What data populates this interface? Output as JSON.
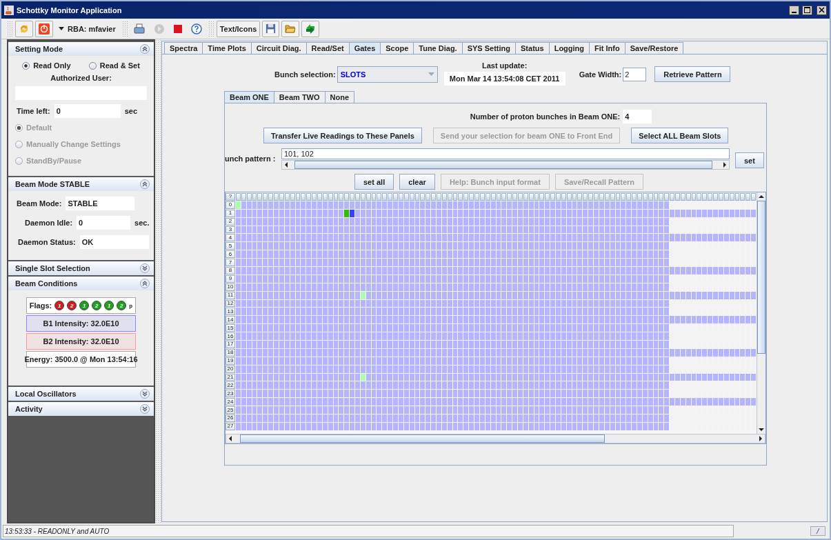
{
  "window": {
    "title": "Schottky Monitor Application"
  },
  "toolbar": {
    "groups": [
      [
        {
          "kind": "refresh"
        },
        {
          "kind": "power"
        },
        {
          "kind": "menu",
          "label": "RBA: mfavier"
        }
      ],
      [
        {
          "kind": "print"
        },
        {
          "kind": "play"
        },
        {
          "kind": "stop"
        },
        {
          "kind": "help"
        }
      ],
      [
        {
          "kind": "text",
          "label": "Text/Icons"
        },
        {
          "kind": "save"
        },
        {
          "kind": "open"
        },
        {
          "kind": "sync"
        }
      ]
    ]
  },
  "sidebar": {
    "sections": [
      {
        "kind": "setting",
        "title": "Setting Mode",
        "expanded": true,
        "radios": [
          {
            "label": "Read Only",
            "selected": true
          },
          {
            "label": "Read & Set",
            "selected": false
          }
        ],
        "user_label": "Authorized User:",
        "time_label": "Time left:",
        "time_value": "0",
        "time_unit": "sec",
        "modes": [
          {
            "label": "Default",
            "selected": true,
            "disabled": true
          },
          {
            "label": "Manually Change Settings",
            "selected": false,
            "disabled": true
          },
          {
            "label": "StandBy/Pause",
            "selected": false,
            "disabled": true
          }
        ]
      },
      {
        "kind": "fields",
        "title": "Beam Mode STABLE",
        "expanded": true,
        "fields": [
          {
            "label": "Beam Mode:",
            "value": "STABLE"
          },
          {
            "label": "Daemon Idle:",
            "value": "0",
            "unit": "sec."
          },
          {
            "label": "Daemon Status:",
            "value": "OK"
          }
        ]
      },
      {
        "kind": "empty",
        "title": "Single Slot Selection",
        "expanded": false
      },
      {
        "kind": "conditions",
        "title": "Beam Conditions",
        "expanded": true,
        "flags_label": "Flags:",
        "lights": [
          {
            "label": "1",
            "color": "#cc2020"
          },
          {
            "label": "2",
            "color": "#cc2020"
          },
          {
            "label": "1",
            "color": "#20a020"
          },
          {
            "label": "2",
            "color": "#20a020"
          },
          {
            "label": "1",
            "color": "#20a020"
          },
          {
            "label": "2",
            "color": "#20a020"
          }
        ],
        "flags_suffix": "p",
        "intensities": [
          {
            "text": "B1 Intensity: 32.0E10",
            "color": "#8888ff"
          },
          {
            "text": "B2 Intensity: 32.0E10",
            "color": "#ff9999"
          }
        ],
        "energy": "Energy: 3500.0 @ Mon 13:54:16"
      },
      {
        "kind": "empty",
        "title": "Local Oscillators",
        "expanded": false
      },
      {
        "kind": "empty",
        "title": "Activity",
        "expanded": false
      }
    ]
  },
  "tabs": [
    {
      "label": "Spectra",
      "selected": false
    },
    {
      "label": "Time Plots",
      "selected": false
    },
    {
      "label": "Circuit Diag.",
      "selected": false
    },
    {
      "label": "Read/Set",
      "selected": false
    },
    {
      "label": "Gates",
      "selected": true
    },
    {
      "label": "Scope",
      "selected": false
    },
    {
      "label": "Tune Diag.",
      "selected": false
    },
    {
      "label": "SYS Setting",
      "selected": false
    },
    {
      "label": "Status",
      "selected": false
    },
    {
      "label": "Logging",
      "selected": false
    },
    {
      "label": "Fit Info",
      "selected": false
    },
    {
      "label": "Save/Restore",
      "selected": false
    }
  ],
  "gates": {
    "bunch_label": "Bunch selection:",
    "bunch_value": "SLOTS",
    "update_label": "Last update:",
    "update_value": "Mon Mar 14 13:54:08 CET 2011",
    "gate_label": "Gate Width:",
    "gate_value": "2",
    "retrieve_button": "Retrieve Pattern",
    "beam_tabs": [
      {
        "label": "Beam ONE",
        "selected": true
      },
      {
        "label": "Beam TWO",
        "selected": false
      },
      {
        "label": "None",
        "selected": false
      }
    ],
    "count_label": "Number of proton bunches in Beam ONE:",
    "count_value": "4",
    "actions": [
      {
        "label": "Transfer Live Readings to These Panels",
        "disabled": false
      },
      {
        "label": "Send your selection for beam ONE to Front End",
        "disabled": true
      },
      {
        "label": "Select ALL Beam Slots",
        "disabled": false
      }
    ],
    "pattern_label": "unch pattern :",
    "pattern_value": "101, 102",
    "set_button": "set",
    "pattern_actions": [
      {
        "label": "set all",
        "disabled": false
      },
      {
        "label": "clear",
        "disabled": false
      },
      {
        "label": "Help: Bunch input format",
        "disabled": true
      },
      {
        "label": "Save/Recall Pattern",
        "disabled": true
      }
    ],
    "grid": {
      "corner": "?",
      "rows": [
        {
          "label": "0",
          "kind": "short",
          "cells": [
            {
              "color": "#aaffaa"
            }
          ]
        },
        {
          "label": "1",
          "kind": "full",
          "cells": [
            {
              "color": "#b4b4ff"
            },
            {
              "color": "#b4b4ff"
            },
            {
              "color": "#b4b4ff"
            },
            {
              "color": "#b4b4ff"
            },
            {
              "color": "#b4b4ff"
            },
            {
              "color": "#b4b4ff"
            },
            {
              "color": "#b4b4ff"
            },
            {
              "color": "#b4b4ff"
            },
            {
              "color": "#b4b4ff"
            },
            {
              "color": "#b4b4ff"
            },
            {
              "color": "#b4b4ff"
            },
            {
              "color": "#b4b4ff"
            },
            {
              "color": "#b4b4ff"
            },
            {
              "color": "#b4b4ff"
            },
            {
              "color": "#b4b4ff"
            },
            {
              "color": "#b4b4ff"
            },
            {
              "color": "#b4b4ff"
            },
            {
              "color": "#b4b4ff"
            },
            {
              "color": "#b4b4ff"
            },
            {
              "color": "#b4b4ff"
            },
            {
              "color": "#33bb00"
            },
            {
              "color": "#3344ff"
            }
          ]
        },
        {
          "label": "2",
          "kind": "short"
        },
        {
          "label": "3",
          "kind": "short"
        },
        {
          "label": "4",
          "kind": "full"
        },
        {
          "label": "5",
          "kind": "short"
        },
        {
          "label": "6",
          "kind": "short"
        },
        {
          "label": "7",
          "kind": "short"
        },
        {
          "label": "8",
          "kind": "full"
        },
        {
          "label": "9",
          "kind": "short"
        },
        {
          "label": "10",
          "kind": "short"
        },
        {
          "label": "11",
          "kind": "full",
          "cells": [
            {
              "color": "#b4b4ff"
            },
            {
              "color": "#b4b4ff"
            },
            {
              "color": "#b4b4ff"
            },
            {
              "color": "#b4b4ff"
            },
            {
              "color": "#b4b4ff"
            },
            {
              "color": "#b4b4ff"
            },
            {
              "color": "#b4b4ff"
            },
            {
              "color": "#b4b4ff"
            },
            {
              "color": "#b4b4ff"
            },
            {
              "color": "#b4b4ff"
            },
            {
              "color": "#b4b4ff"
            },
            {
              "color": "#b4b4ff"
            },
            {
              "color": "#b4b4ff"
            },
            {
              "color": "#b4b4ff"
            },
            {
              "color": "#b4b4ff"
            },
            {
              "color": "#b4b4ff"
            },
            {
              "color": "#b4b4ff"
            },
            {
              "color": "#b4b4ff"
            },
            {
              "color": "#b4b4ff"
            },
            {
              "color": "#b4b4ff"
            },
            {
              "color": "#b4b4ff"
            },
            {
              "color": "#b4b4ff"
            },
            {
              "color": "#b4b4ff"
            },
            {
              "color": "#aaffaa"
            }
          ]
        },
        {
          "label": "12",
          "kind": "short"
        },
        {
          "label": "13",
          "kind": "short"
        },
        {
          "label": "14",
          "kind": "full"
        },
        {
          "label": "15",
          "kind": "short"
        },
        {
          "label": "16",
          "kind": "short"
        },
        {
          "label": "17",
          "kind": "short"
        },
        {
          "label": "18",
          "kind": "full"
        },
        {
          "label": "19",
          "kind": "short"
        },
        {
          "label": "20",
          "kind": "short"
        },
        {
          "label": "21",
          "kind": "full",
          "cells": [
            {
              "color": "#b4b4ff"
            },
            {
              "color": "#b4b4ff"
            },
            {
              "color": "#b4b4ff"
            },
            {
              "color": "#b4b4ff"
            },
            {
              "color": "#b4b4ff"
            },
            {
              "color": "#b4b4ff"
            },
            {
              "color": "#b4b4ff"
            },
            {
              "color": "#b4b4ff"
            },
            {
              "color": "#b4b4ff"
            },
            {
              "color": "#b4b4ff"
            },
            {
              "color": "#b4b4ff"
            },
            {
              "color": "#b4b4ff"
            },
            {
              "color": "#b4b4ff"
            },
            {
              "color": "#b4b4ff"
            },
            {
              "color": "#b4b4ff"
            },
            {
              "color": "#b4b4ff"
            },
            {
              "color": "#b4b4ff"
            },
            {
              "color": "#b4b4ff"
            },
            {
              "color": "#b4b4ff"
            },
            {
              "color": "#b4b4ff"
            },
            {
              "color": "#b4b4ff"
            },
            {
              "color": "#b4b4ff"
            },
            {
              "color": "#b4b4ff"
            },
            {
              "color": "#aaffaa"
            }
          ]
        },
        {
          "label": "22",
          "kind": "short"
        },
        {
          "label": "23",
          "kind": "short"
        },
        {
          "label": "24",
          "kind": "full"
        },
        {
          "label": "25",
          "kind": "short"
        },
        {
          "label": "26",
          "kind": "short"
        },
        {
          "label": "27",
          "kind": "short"
        }
      ]
    }
  },
  "status_bar": {
    "message": "13:53:33 - READONLY and AUTO"
  }
}
